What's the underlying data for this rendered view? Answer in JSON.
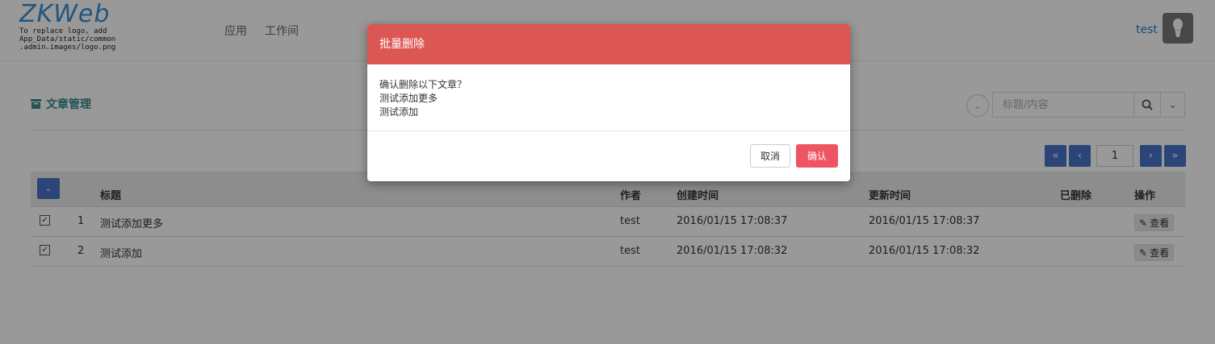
{
  "header": {
    "logo_title": "ZKWeb",
    "logo_note": "To replace logo, add\nApp_Data/static/common\n.admin.images/logo.png",
    "nav": [
      "应用",
      "工作间"
    ],
    "user_name": "test"
  },
  "page": {
    "title": "文章管理",
    "search_placeholder": "标题/内容"
  },
  "pager": {
    "first": "«",
    "prev": "‹",
    "current_page": "1",
    "next": "›",
    "last": "»"
  },
  "table": {
    "columns": [
      "标题",
      "作者",
      "创建时间",
      "更新时间",
      "已删除",
      "操作"
    ],
    "rows": [
      {
        "index": "1",
        "title": "测试添加更多",
        "author": "test",
        "created": "2016/01/15 17:08:37",
        "updated": "2016/01/15 17:08:37",
        "deleted": "",
        "action": "查看"
      },
      {
        "index": "2",
        "title": "测试添加",
        "author": "test",
        "created": "2016/01/15 17:08:32",
        "updated": "2016/01/15 17:08:32",
        "deleted": "",
        "action": "查看"
      }
    ]
  },
  "modal": {
    "title": "批量删除",
    "lines": [
      "确认删除以下文章？",
      "测试添加更多",
      "测试添加"
    ],
    "cancel_label": "取消",
    "confirm_label": "确认"
  },
  "colors": {
    "accent": "#4a74c9",
    "modal_header": "#dc5753",
    "confirm": "#ee5563",
    "title_teal": "#3b8a8a"
  }
}
